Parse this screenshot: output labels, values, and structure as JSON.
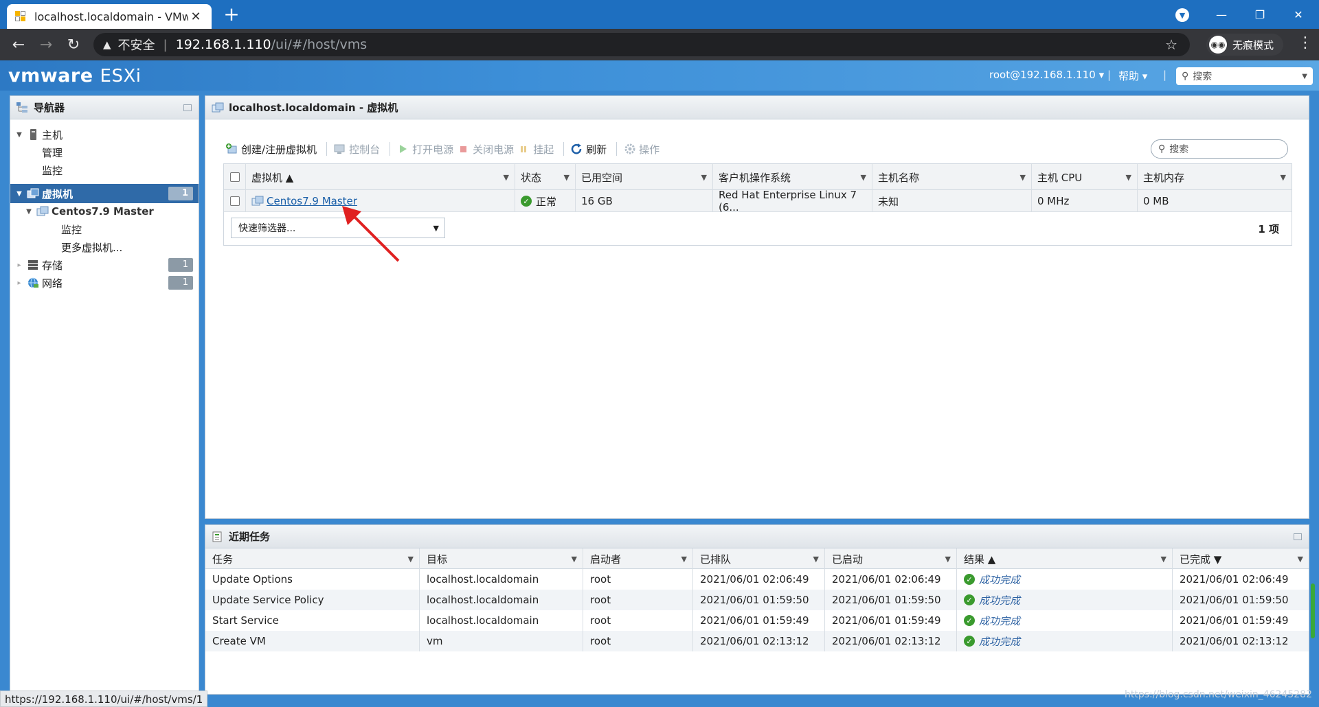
{
  "browser": {
    "tab_title": "localhost.localdomain - VMware ESXi",
    "tab_close": "✕",
    "new_tab": "+",
    "insecure_label": "不安全",
    "url_host": "192.168.1.110",
    "url_path": "/ui/#/host/vms",
    "incognito_label": "无痕模式",
    "status_url": "https://192.168.1.110/ui/#/host/vms/1"
  },
  "header": {
    "logo": "vmware",
    "product": "ESXi",
    "user": "root@192.168.1.110 ▾",
    "help": "帮助 ▾",
    "search_placeholder": "搜索"
  },
  "navigator": {
    "title": "导航器",
    "host": "主机",
    "host_children": [
      "管理",
      "监控"
    ],
    "vms": "虚拟机",
    "vms_count": "1",
    "vm_name": "Centos7.9 Master",
    "vm_children": [
      "监控",
      "更多虚拟机..."
    ],
    "storage": "存储",
    "storage_count": "1",
    "network": "网络",
    "network_count": "1"
  },
  "main": {
    "title": "localhost.localdomain - 虚拟机",
    "toolbar": {
      "create": "创建/注册虚拟机",
      "console": "控制台",
      "power_on": "打开电源",
      "power_off": "关闭电源",
      "suspend": "挂起",
      "refresh": "刷新",
      "actions": "操作"
    },
    "search_placeholder": "搜索",
    "columns": [
      "虚拟机 ▲",
      "状态",
      "已用空间",
      "客户机操作系统",
      "主机名称",
      "主机 CPU",
      "主机内存"
    ],
    "rows": [
      {
        "name": "Centos7.9 Master",
        "status": "正常",
        "used_space": "16 GB",
        "guest_os": "Red Hat Enterprise Linux 7 (6...",
        "hostname": "未知",
        "cpu": "0 MHz",
        "memory": "0 MB"
      }
    ],
    "quick_filter": "快速筛选器...",
    "item_count": "1 项"
  },
  "tasks": {
    "title": "近期任务",
    "columns": [
      "任务",
      "目标",
      "启动者",
      "已排队",
      "已启动",
      "结果 ▲",
      "已完成 ▼"
    ],
    "rows": [
      {
        "task": "Update Options",
        "target": "localhost.localdomain",
        "initiator": "root",
        "queued": "2021/06/01 02:06:49",
        "started": "2021/06/01 02:06:49",
        "result": "成功完成",
        "completed": "2021/06/01 02:06:49"
      },
      {
        "task": "Update Service Policy",
        "target": "localhost.localdomain",
        "initiator": "root",
        "queued": "2021/06/01 01:59:50",
        "started": "2021/06/01 01:59:50",
        "result": "成功完成",
        "completed": "2021/06/01 01:59:50"
      },
      {
        "task": "Start Service",
        "target": "localhost.localdomain",
        "initiator": "root",
        "queued": "2021/06/01 01:59:49",
        "started": "2021/06/01 01:59:49",
        "result": "成功完成",
        "completed": "2021/06/01 01:59:49"
      },
      {
        "task": "Create VM",
        "target": "vm",
        "initiator": "root",
        "queued": "2021/06/01 02:13:12",
        "started": "2021/06/01 02:13:12",
        "result": "成功完成",
        "completed": "2021/06/01 02:13:12"
      }
    ]
  },
  "watermark": "https://blog.csdn.net/weixin_46245282",
  "colors": {
    "accent": "#1e6fc0",
    "nav_selected": "#2f6aa8",
    "success": "#3a9a2e",
    "annotation": "#e02020"
  }
}
